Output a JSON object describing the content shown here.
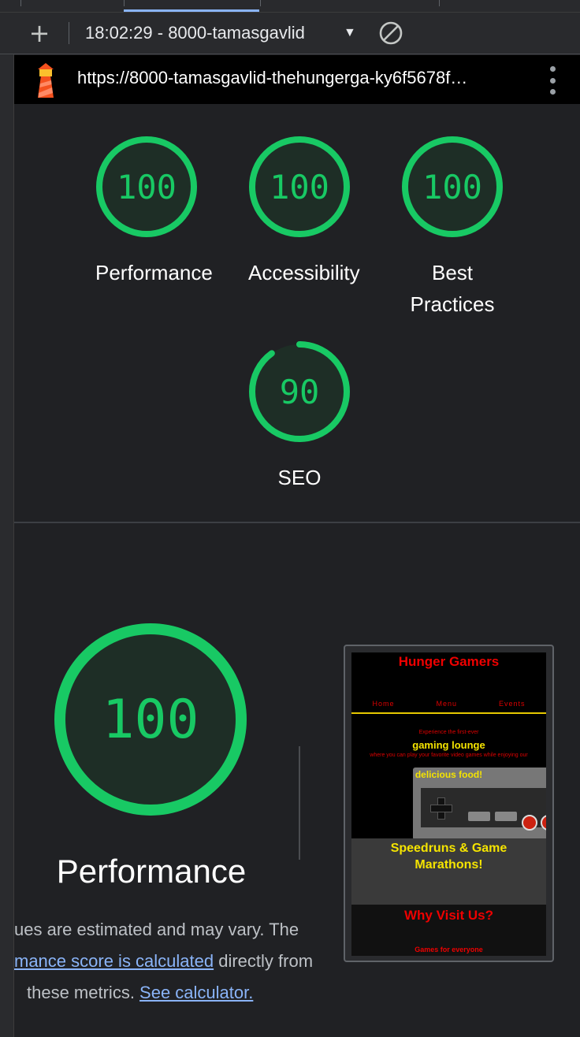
{
  "toolbar": {
    "report_select_label": "18:02:29 - 8000-tamasgavlid",
    "new_report_icon": "plus-icon",
    "clear_icon": "block-icon"
  },
  "urlbar": {
    "url": "https://8000-tamasgavlid-thehungerga-ky6f5678f…",
    "logo_icon": "lighthouse-icon",
    "menu_icon": "more-vertical-icon"
  },
  "gauges": [
    {
      "score": "100",
      "label": "Performance",
      "value": 100
    },
    {
      "score": "100",
      "label": "Accessibility",
      "value": 100
    },
    {
      "score": "100",
      "label": "Best Practices",
      "value": 100
    },
    {
      "score": "90",
      "label": "SEO",
      "value": 90
    }
  ],
  "performance": {
    "score": "100",
    "value": 100,
    "title": "Performance",
    "desc_line1": "ues are estimated and may vary. The",
    "desc_link1": "mance score is calculated",
    "desc_line2_rest": " directly from",
    "desc_line3": "these metrics. ",
    "desc_link2": "See calculator."
  },
  "thumbnail": {
    "site_title": "Hunger Gamers",
    "nav": [
      "Home",
      "Menu",
      "Events"
    ],
    "intro_small": "Experience the first-ever",
    "intro_big": "gaming lounge",
    "intro_small2": "where you can play your favorite video games while enjoying our",
    "intro_big2": "delicious food!",
    "heading1": "Speedruns & Game Marathons!",
    "heading2": "Why Visit Us?",
    "footer_text": "Games for everyone"
  },
  "colors": {
    "gauge_green": "#18c964",
    "gauge_fill": "#1e2e26",
    "background": "#202124",
    "link": "#8ab4f8"
  }
}
